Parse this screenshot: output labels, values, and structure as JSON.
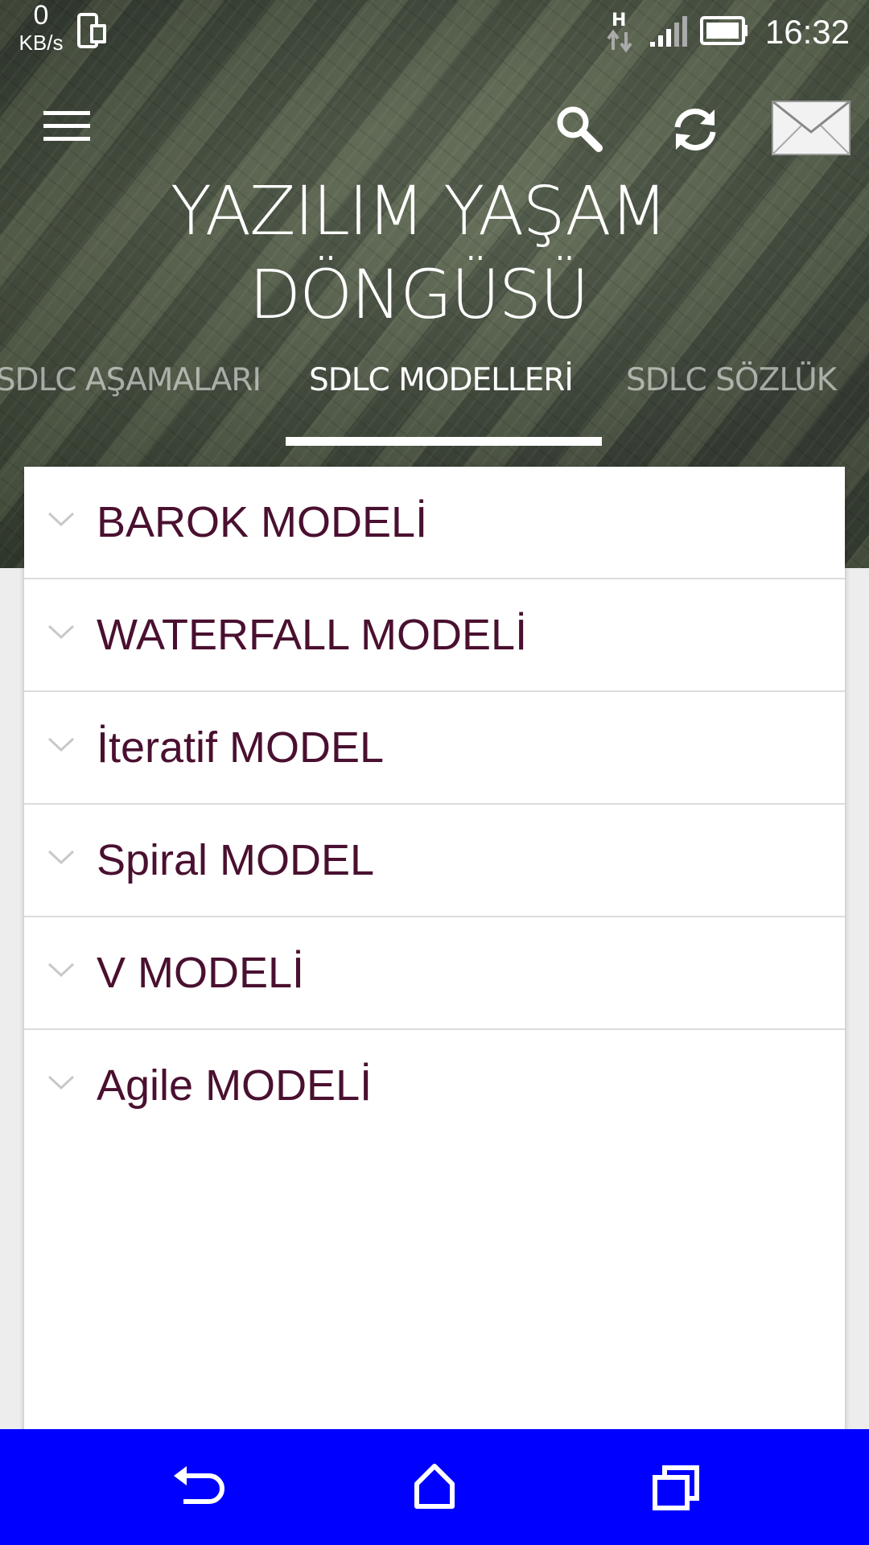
{
  "status_bar": {
    "speed_value": "0",
    "speed_unit": "KB/s",
    "network_type": "H",
    "time": "16:32"
  },
  "action_bar": {
    "icons": [
      "menu-icon",
      "search-icon",
      "refresh-icon",
      "mail-icon"
    ]
  },
  "app": {
    "title_line1": "YAZILIM YAŞAM",
    "title_line2": "DÖNGÜSÜ"
  },
  "tabs": [
    {
      "label": "SDLC AŞAMALARI",
      "active": false
    },
    {
      "label": "SDLC MODELLERİ",
      "active": true
    },
    {
      "label": "SDLC SÖZLÜK",
      "active": false
    }
  ],
  "models": [
    {
      "label": "BAROK MODELİ"
    },
    {
      "label": "WATERFALL MODELİ"
    },
    {
      "label": "İteratif MODEL"
    },
    {
      "label": "Spiral MODEL"
    },
    {
      "label": "V MODELİ"
    },
    {
      "label": "Agile MODELİ"
    }
  ],
  "nav_bar": {
    "buttons": [
      "back-icon",
      "home-icon",
      "recents-icon"
    ]
  },
  "colors": {
    "item_text": "#4a1030",
    "nav_bar": "#0000ff",
    "divider": "#dcdcdc"
  }
}
